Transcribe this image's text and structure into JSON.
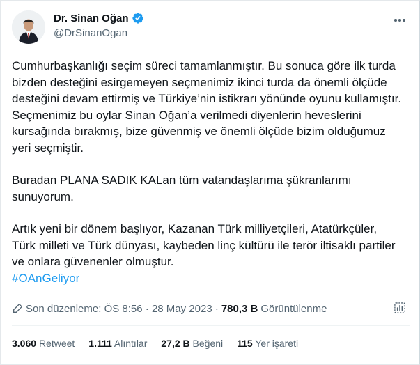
{
  "author": {
    "name": "Dr. Sinan Oğan",
    "handle": "@DrSinanOgan",
    "verified": true
  },
  "tweet": {
    "paragraphs": [
      "Cumhurbaşkanlığı seçim süreci tamamlanmıştır. Bu sonuca göre ilk turda bizden desteğini esirgemeyen seçmenimiz ikinci turda da önemli ölçüde desteğini devam ettirmiş ve Türkiye’nin istikrarı yönünde oyunu kullamıştır. Seçmenimiz bu oylar Sinan Oğan’a verilmedi diyenlerin heveslerini kursağında bırakmış, bize güvenmiş ve önemli ölçüde bizim olduğumuz yeri seçmiştir.",
      "Buradan PLANA SADIK KALan tüm vatandaşlarıma şükranlarımı sunuyorum.",
      "Artık yeni bir dönem başlıyor, Kazanan Türk milliyetçileri, Atatürkçüler, Türk milleti ve Türk dünyası, kaybeden linç kültürü ile terör iltisaklı partiler ve onlara güvenenler olmuştur."
    ],
    "hashtag": "#OAnGeliyor"
  },
  "meta": {
    "edited_label": "Son düzenleme: ÖS 8:56 · 28 May 2023 ·",
    "views": "780,3 B",
    "views_label": "Görüntülenme"
  },
  "stats": {
    "retweets": {
      "count": "3.060",
      "label": "Retweet"
    },
    "quotes": {
      "count": "1.111",
      "label": "Alıntılar"
    },
    "likes": {
      "count": "27,2 B",
      "label": "Beğeni"
    },
    "bookmarks": {
      "count": "115",
      "label": "Yer işareti"
    }
  },
  "icons": {
    "verified": "verified-badge-icon",
    "more": "more-options-icon",
    "edit": "pencil-edit-icon",
    "analytics": "analytics-icon"
  },
  "colors": {
    "accent": "#1d9bf0",
    "text": "#0f1419",
    "secondary": "#536471",
    "divider": "#eff3f4"
  }
}
